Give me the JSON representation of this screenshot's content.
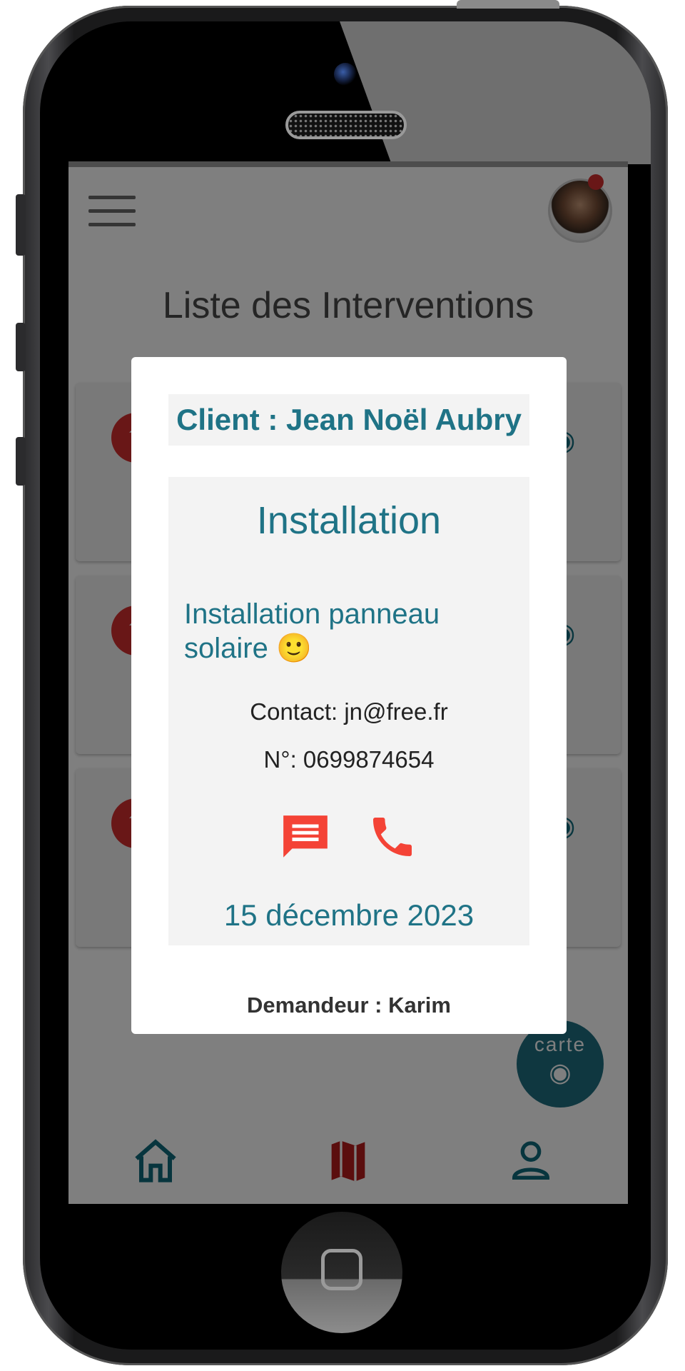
{
  "app": {
    "page_title": "Liste des Interventions",
    "fab_label": "carte"
  },
  "icons": {
    "menu": "menu-icon",
    "avatar": "avatar",
    "notification": "notification-dot",
    "card_badge": "upload-icon",
    "card_view": "eye-icon",
    "fab": "eye-icon",
    "nav_home": "home-icon",
    "nav_map": "map-icon",
    "nav_profile": "user-icon",
    "message": "message-icon",
    "call": "phone-icon"
  },
  "colors": {
    "accent": "#1f7386",
    "alert": "#f44336",
    "overlay": "rgba(0,0,0,0.5)"
  },
  "modal": {
    "client": "Client : Jean Noël Aubry",
    "type": "Installation",
    "description": "Installation panneau solaire 🙂",
    "contact": "Contact: jn@free.fr",
    "phone": "N°: 0699874654",
    "date": "15 décembre 2023",
    "requester": "Demandeur : Karim"
  }
}
